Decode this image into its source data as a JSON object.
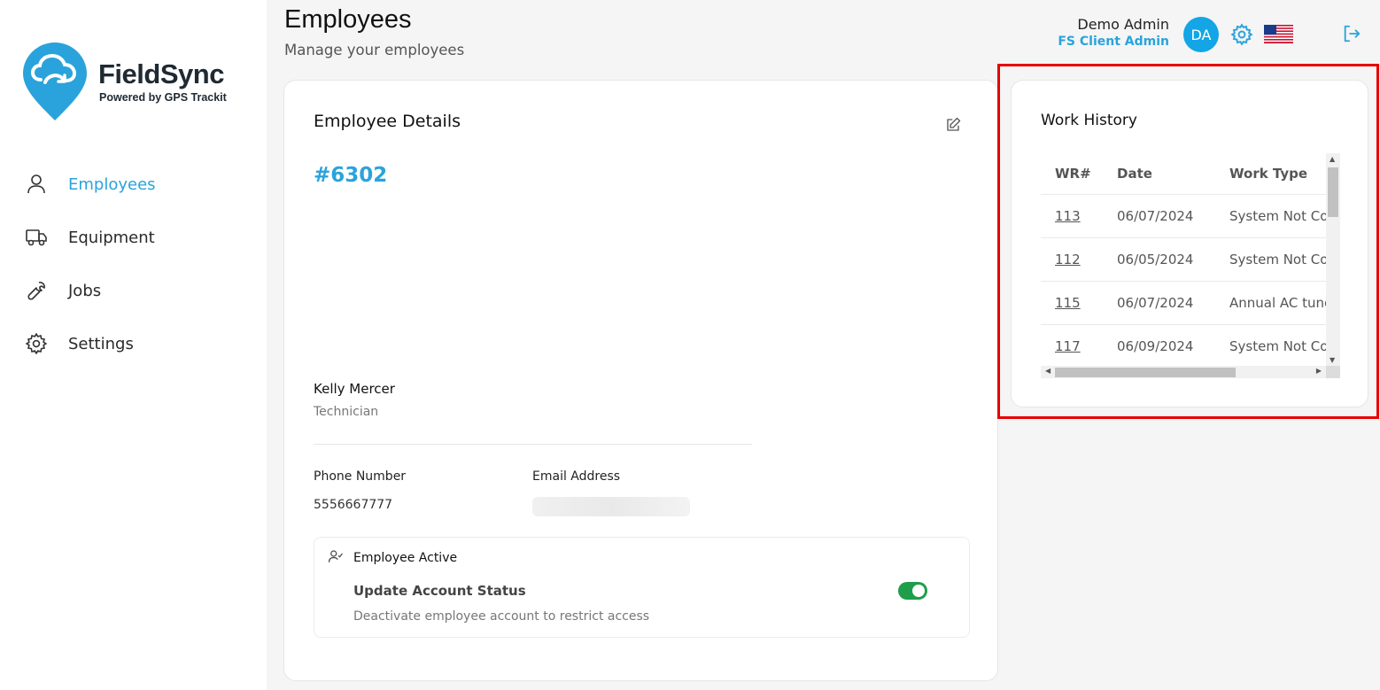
{
  "brand": {
    "name": "FieldSync",
    "tagline": "Powered by GPS Trackit",
    "accent": "#2aa3dc"
  },
  "sidebar": {
    "items": [
      {
        "label": "Employees",
        "icon": "user-icon",
        "active": true
      },
      {
        "label": "Equipment",
        "icon": "truck-icon",
        "active": false
      },
      {
        "label": "Jobs",
        "icon": "wrench-icon",
        "active": false
      },
      {
        "label": "Settings",
        "icon": "gear-icon",
        "active": false
      }
    ]
  },
  "header": {
    "title": "Employees",
    "subtitle": "Manage your employees",
    "user_name": "Demo Admin",
    "user_role": "FS Client Admin",
    "avatar_initials": "DA"
  },
  "details": {
    "title": "Employee Details",
    "employee_id": "#6302",
    "name": "Kelly Mercer",
    "role": "Technician",
    "phone_label": "Phone Number",
    "phone_value": "5556667777",
    "email_label": "Email Address",
    "status_title": "Employee Active",
    "status_heading": "Update Account Status",
    "status_description": "Deactivate employee account to restrict access",
    "active": true
  },
  "work_history": {
    "title": "Work History",
    "columns": [
      "WR#",
      "Date",
      "Work Type"
    ],
    "rows": [
      {
        "wr": "113",
        "date": "06/07/2024",
        "type": "System Not Cooling"
      },
      {
        "wr": "112",
        "date": "06/05/2024",
        "type": "System Not Cooling"
      },
      {
        "wr": "115",
        "date": "06/07/2024",
        "type": "Annual AC tune-up"
      },
      {
        "wr": "117",
        "date": "06/09/2024",
        "type": "System Not Cooling"
      }
    ]
  }
}
